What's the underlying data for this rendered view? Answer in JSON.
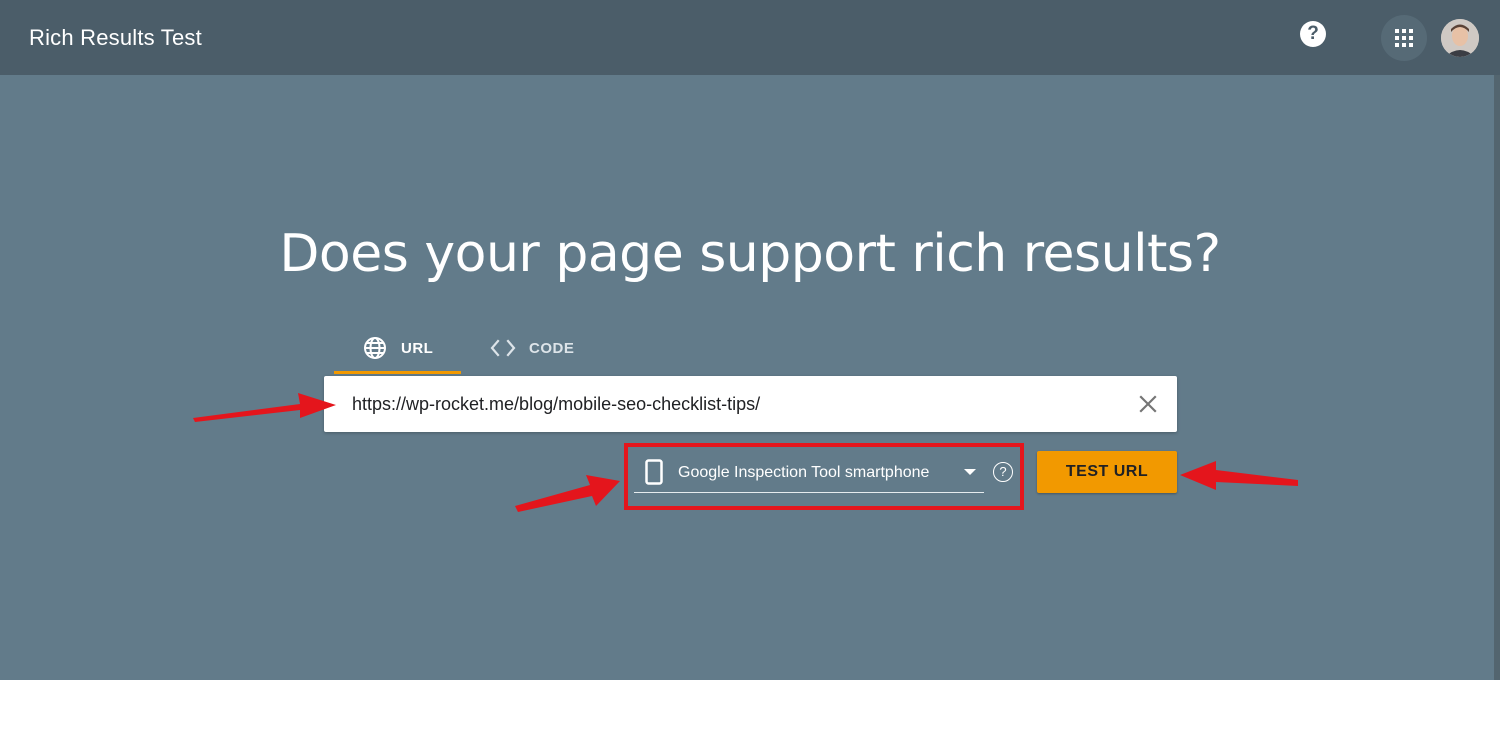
{
  "header": {
    "title": "Rich Results Test",
    "help_glyph": "?",
    "icons": [
      "help-icon",
      "apps-grid-icon",
      "avatar"
    ]
  },
  "hero": {
    "headline": "Does your page support rich results?"
  },
  "tabs": [
    {
      "label": "URL",
      "icon": "globe-icon",
      "selected": true
    },
    {
      "label": "CODE",
      "icon": "code-brackets-icon",
      "selected": false
    }
  ],
  "url_field": {
    "value": "https://wp-rocket.me/blog/mobile-seo-checklist-tips/",
    "clear_icon": "close-icon"
  },
  "device_select": {
    "selected": "Google Inspection Tool smartphone",
    "icon": "smartphone-icon",
    "help_glyph": "?"
  },
  "actions": {
    "test_label": "TEST URL"
  },
  "colors": {
    "topbar": "#4b5d69",
    "hero": "#627b8a",
    "accent": "#f29900",
    "annotation_red": "#e4151c"
  }
}
